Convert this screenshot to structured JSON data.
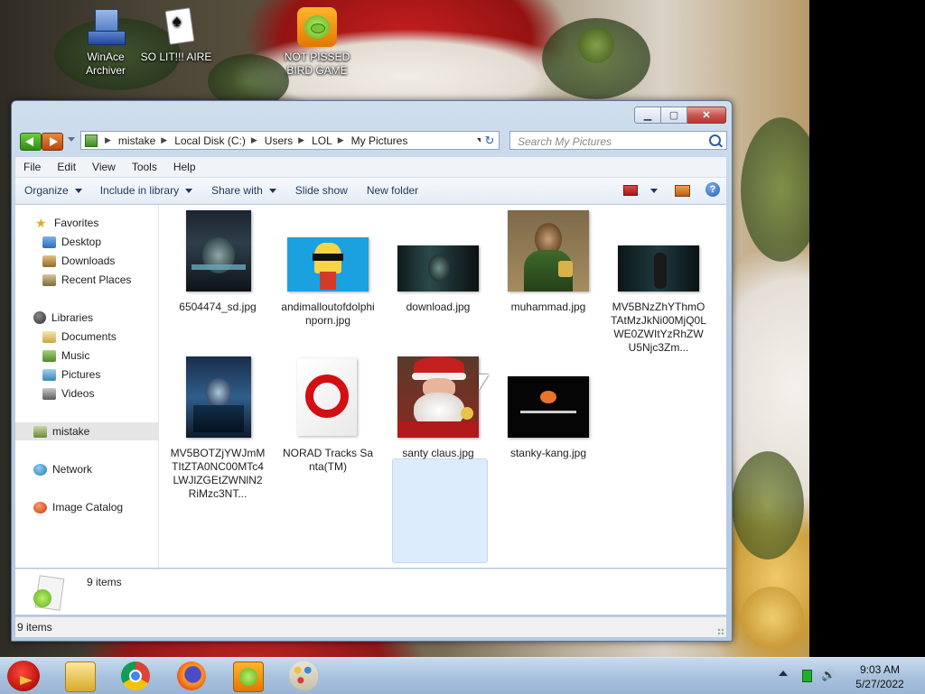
{
  "desktop": {
    "icons": [
      {
        "label_line1": "WinAce",
        "label_line2": "Archiver",
        "icon": "winace-archiver-icon"
      },
      {
        "label_line1": "SO LIT!!! AIRE",
        "label_line2": "",
        "icon": "playing-card-icon"
      },
      {
        "label_line1": "NOT PISSED",
        "label_line2": "BIRD GAME",
        "icon": "green-pig-icon"
      }
    ]
  },
  "window": {
    "caption": {
      "minimize": "minimize",
      "maximize": "maximize",
      "close": "close"
    },
    "address": {
      "crumbs": [
        "mistake",
        "Local Disk (C:)",
        "Users",
        "LOL",
        "My Pictures"
      ]
    },
    "search": {
      "placeholder": "Search My Pictures"
    },
    "menu": [
      "File",
      "Edit",
      "View",
      "Tools",
      "Help"
    ],
    "commands": {
      "organize": "Organize",
      "include_in_library": "Include in library",
      "share_with": "Share with",
      "slide_show": "Slide show",
      "new_folder": "New folder"
    },
    "nav": {
      "favorites": "Favorites",
      "desktop": "Desktop",
      "downloads": "Downloads",
      "recent_places": "Recent Places",
      "libraries": "Libraries",
      "documents": "Documents",
      "music": "Music",
      "pictures": "Pictures",
      "videos": "Videos",
      "mistake": "mistake",
      "network": "Network",
      "image_catalog": "Image Catalog"
    },
    "files": [
      {
        "name": "6504474_sd.jpg"
      },
      {
        "name": "andimalloutofdolphinporn.jpg"
      },
      {
        "name": "download.jpg"
      },
      {
        "name": "muhammad.jpg"
      },
      {
        "name": "MV5BNzZhYThmOTAtMzJkNi00MjQ0LWE0ZWItYzRhZWU5Njc3Zm..."
      },
      {
        "name": "MV5BOTZjYWJmMTItZTA0NC00MTc4LWJlZGEtZWNlN2RiMzc3NT..."
      },
      {
        "name": "NORAD Tracks Santa(TM)"
      },
      {
        "name": "santy claus.jpg"
      },
      {
        "name": "stanky-kang.jpg"
      }
    ],
    "details": {
      "count": "9 items"
    },
    "status": {
      "count": "9 items"
    }
  },
  "taskbar": {
    "clock_time": "9:03 AM",
    "clock_date": "5/27/2022"
  },
  "colors": {
    "window_frame": "#b9cde3",
    "selection": "#ddecfd",
    "taskbar": "#a8c2de"
  }
}
